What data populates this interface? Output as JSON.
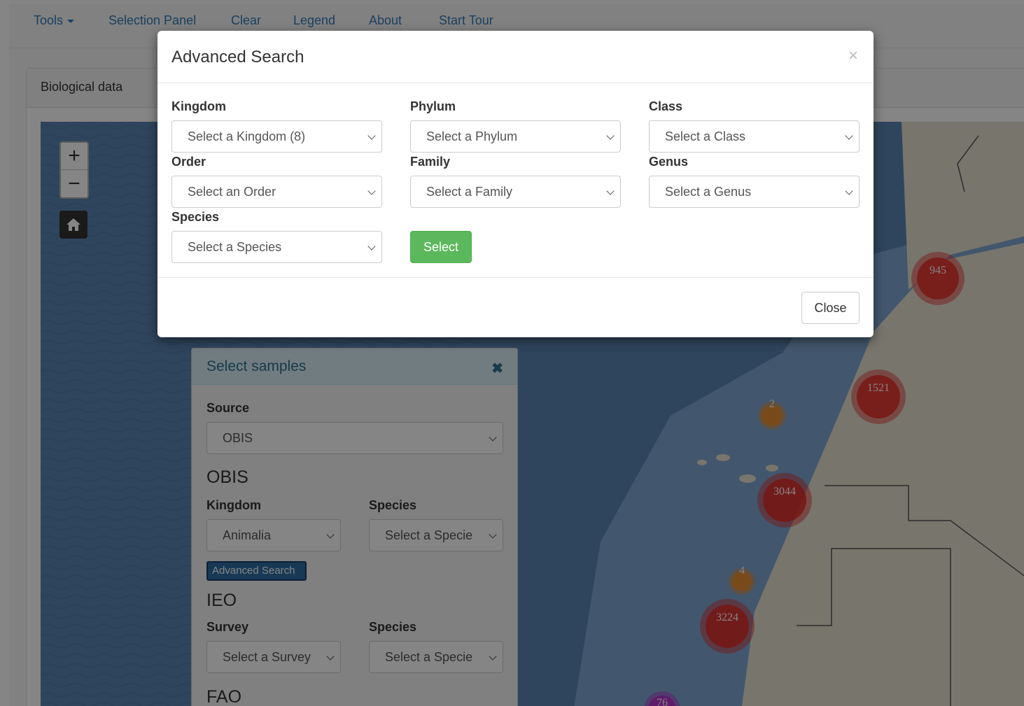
{
  "navbar": {
    "tools": "Tools",
    "selection_panel": "Selection Panel",
    "clear": "Clear",
    "legend": "Legend",
    "about": "About",
    "start_tour": "Start Tour"
  },
  "panel": {
    "title": "Biological data"
  },
  "map": {
    "clusters": [
      {
        "count": "945",
        "color": "red"
      },
      {
        "count": "1521",
        "color": "red"
      },
      {
        "count": "2",
        "color": "orange"
      },
      {
        "count": "3044",
        "color": "red"
      },
      {
        "count": "4",
        "color": "orange"
      },
      {
        "count": "3224",
        "color": "red"
      },
      {
        "count": "76",
        "color": "purple"
      }
    ]
  },
  "samples": {
    "title": "Select samples",
    "source_label": "Source",
    "source_value": "OBIS",
    "obis_heading": "OBIS",
    "kingdom_label": "Kingdom",
    "kingdom_value": "Animalia",
    "species_label": "Species",
    "species_value": "Select a Specie",
    "advanced_search": "Advanced Search",
    "ieo_heading": "IEO",
    "survey_label": "Survey",
    "survey_value": "Select a Survey",
    "ieo_species_label": "Species",
    "ieo_species_value": "Select a Specie",
    "fao_heading": "FAO"
  },
  "modal": {
    "title": "Advanced Search",
    "close_x": "×",
    "kingdom_label": "Kingdom",
    "kingdom_value": "Select a Kingdom (8)",
    "phylum_label": "Phylum",
    "phylum_value": "Select a Phylum",
    "class_label": "Class",
    "class_value": "Select a Class",
    "order_label": "Order",
    "order_value": "Select an Order",
    "family_label": "Family",
    "family_value": "Select a Family",
    "genus_label": "Genus",
    "genus_value": "Select a Genus",
    "species_label": "Species",
    "species_value": "Select a Species",
    "select_button": "Select",
    "close_button": "Close"
  },
  "colors": {
    "link": "#337ab7",
    "success": "#5cb85c",
    "cluster_red": "#e62823",
    "cluster_orange": "#f58c1e",
    "cluster_purple": "#be28c8"
  }
}
